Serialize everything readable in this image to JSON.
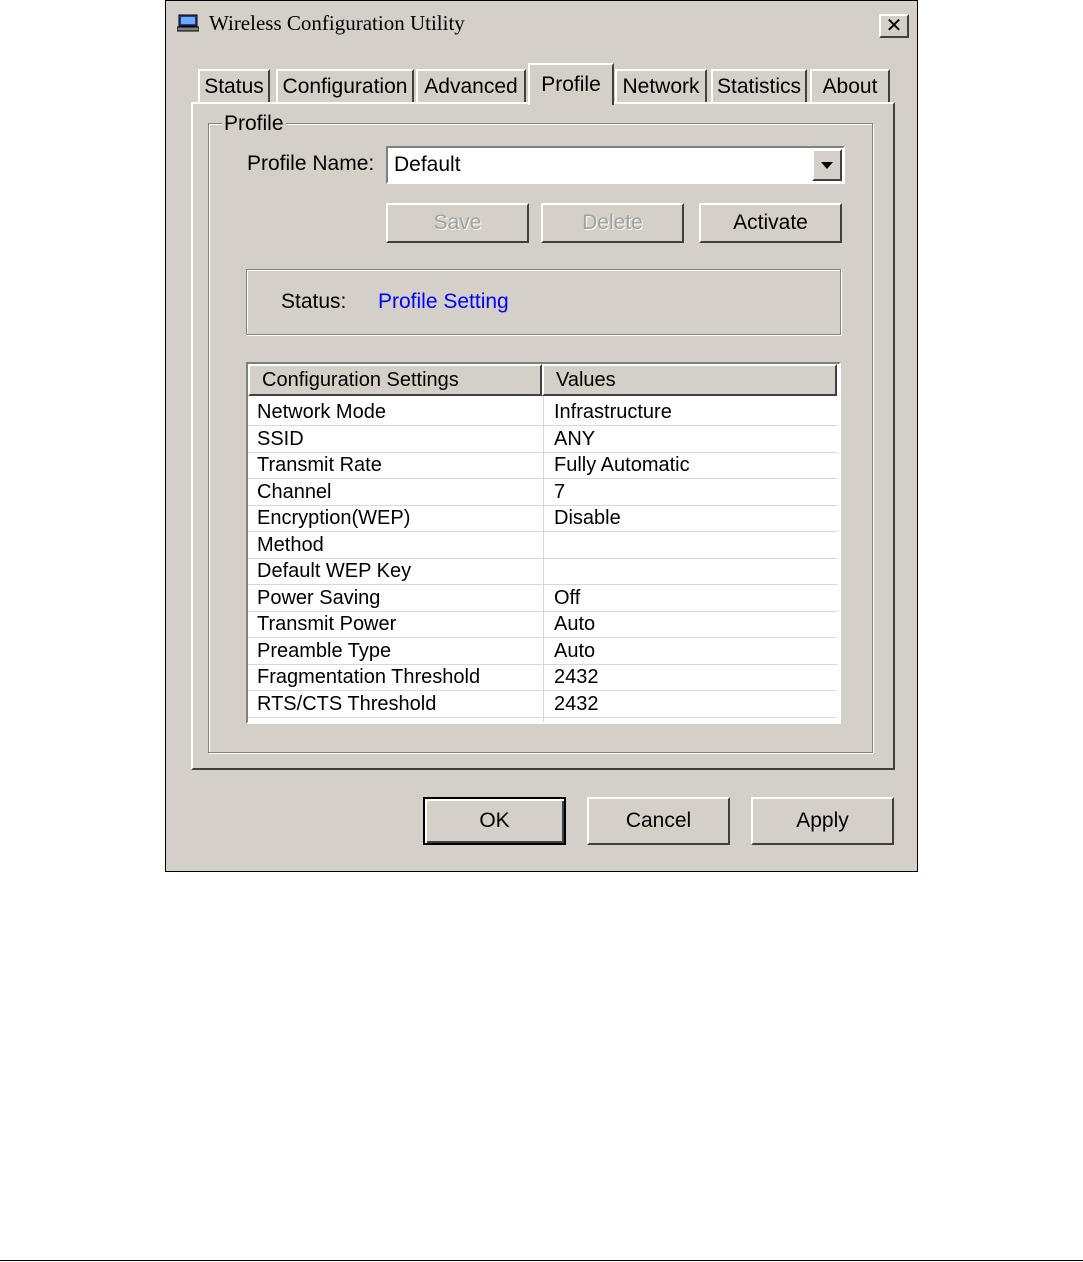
{
  "window": {
    "title": "Wireless Configuration Utility",
    "icons": {
      "app": "computer-icon",
      "close": "close-icon"
    },
    "close_label": "✕"
  },
  "tabs": [
    {
      "label": "Status"
    },
    {
      "label": "Configuration"
    },
    {
      "label": "Advanced"
    },
    {
      "label": "Profile",
      "active": true
    },
    {
      "label": "Network"
    },
    {
      "label": "Statistics"
    },
    {
      "label": "About"
    }
  ],
  "profile": {
    "group_label": "Profile",
    "name_label": "Profile Name:",
    "name_value": "Default",
    "buttons": {
      "save": "Save",
      "delete": "Delete",
      "activate": "Activate"
    },
    "status_label": "Status:",
    "status_value": "Profile Setting",
    "status_color": "#0000ff"
  },
  "settings_table": {
    "headers": [
      "Configuration Settings",
      "Values"
    ],
    "rows": [
      [
        "Network Mode",
        "Infrastructure"
      ],
      [
        "SSID",
        "ANY"
      ],
      [
        "Transmit Rate",
        "Fully Automatic"
      ],
      [
        "Channel",
        "7"
      ],
      [
        "Encryption(WEP)",
        "Disable"
      ],
      [
        "Method",
        ""
      ],
      [
        "Default WEP Key",
        ""
      ],
      [
        "Power Saving",
        "Off"
      ],
      [
        "Transmit Power",
        "Auto"
      ],
      [
        "Preamble Type",
        "Auto"
      ],
      [
        "Fragmentation Threshold",
        "2432"
      ],
      [
        "RTS/CTS Threshold",
        "2432"
      ]
    ]
  },
  "dialog_buttons": {
    "ok": "OK",
    "cancel": "Cancel",
    "apply": "Apply"
  },
  "colors": {
    "face": "#d4d0c8",
    "highlight": "#ffffff",
    "shadow": "#404040"
  }
}
